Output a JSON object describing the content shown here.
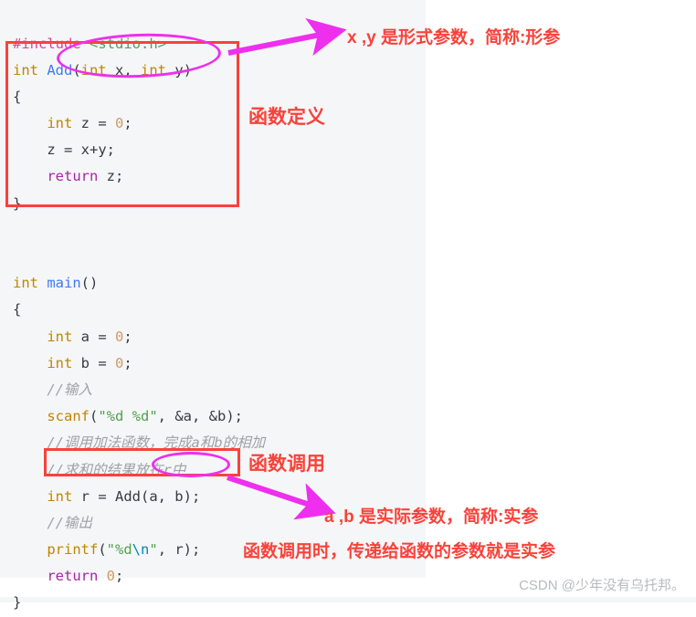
{
  "code_block": {
    "language": "c",
    "background": "#f5f6f7",
    "lines": [
      {
        "tokens": [
          {
            "t": "#include ",
            "c": "k-pre"
          },
          {
            "t": "<stdio.h>",
            "c": "k-inc"
          }
        ]
      },
      {
        "tokens": [
          {
            "t": "int ",
            "c": "k-type"
          },
          {
            "t": "Add",
            "c": "k-fn"
          },
          {
            "t": "(",
            "c": "k-punc"
          },
          {
            "t": "int ",
            "c": "k-type"
          },
          {
            "t": "x",
            "c": "k-id"
          },
          {
            "t": ", ",
            "c": "k-punc"
          },
          {
            "t": "int ",
            "c": "k-type"
          },
          {
            "t": "y",
            "c": "k-id"
          },
          {
            "t": ")",
            "c": "k-punc"
          }
        ]
      },
      {
        "tokens": [
          {
            "t": "{",
            "c": "k-punc"
          }
        ]
      },
      {
        "tokens": [
          {
            "t": "    ",
            "c": "k-punc"
          },
          {
            "t": "int ",
            "c": "k-type"
          },
          {
            "t": "z = ",
            "c": "k-id"
          },
          {
            "t": "0",
            "c": "k-num"
          },
          {
            "t": ";",
            "c": "k-punc"
          }
        ]
      },
      {
        "tokens": [
          {
            "t": "    z = x+y;",
            "c": "k-id"
          }
        ]
      },
      {
        "tokens": [
          {
            "t": "    ",
            "c": "k-punc"
          },
          {
            "t": "return ",
            "c": "k-ret"
          },
          {
            "t": "z;",
            "c": "k-id"
          }
        ]
      },
      {
        "tokens": [
          {
            "t": "}",
            "c": "k-punc"
          }
        ]
      },
      {
        "tokens": []
      },
      {
        "tokens": []
      },
      {
        "tokens": [
          {
            "t": "int ",
            "c": "k-type"
          },
          {
            "t": "main",
            "c": "k-fn"
          },
          {
            "t": "()",
            "c": "k-punc"
          }
        ]
      },
      {
        "tokens": [
          {
            "t": "{",
            "c": "k-punc"
          }
        ]
      },
      {
        "tokens": [
          {
            "t": "    ",
            "c": "k-punc"
          },
          {
            "t": "int ",
            "c": "k-type"
          },
          {
            "t": "a = ",
            "c": "k-id"
          },
          {
            "t": "0",
            "c": "k-num"
          },
          {
            "t": ";",
            "c": "k-punc"
          }
        ]
      },
      {
        "tokens": [
          {
            "t": "    ",
            "c": "k-punc"
          },
          {
            "t": "int ",
            "c": "k-type"
          },
          {
            "t": "b = ",
            "c": "k-id"
          },
          {
            "t": "0",
            "c": "k-num"
          },
          {
            "t": ";",
            "c": "k-punc"
          }
        ]
      },
      {
        "tokens": [
          {
            "t": "    //输入",
            "c": "k-cmt"
          }
        ]
      },
      {
        "tokens": [
          {
            "t": "    ",
            "c": "k-punc"
          },
          {
            "t": "scanf",
            "c": "k-std"
          },
          {
            "t": "(",
            "c": "k-punc"
          },
          {
            "t": "\"%d %d\"",
            "c": "k-str"
          },
          {
            "t": ", &a, &b);",
            "c": "k-id"
          }
        ]
      },
      {
        "tokens": [
          {
            "t": "    //调用加法函数，完成a和b的相加",
            "c": "k-cmt"
          }
        ]
      },
      {
        "tokens": [
          {
            "t": "    //求和的结果放在r中",
            "c": "k-cmt"
          }
        ]
      },
      {
        "tokens": [
          {
            "t": "    ",
            "c": "k-punc"
          },
          {
            "t": "int ",
            "c": "k-type"
          },
          {
            "t": "r = ",
            "c": "k-id"
          },
          {
            "t": "Add",
            "c": "k-id"
          },
          {
            "t": "(a, b);",
            "c": "k-id"
          }
        ]
      },
      {
        "tokens": [
          {
            "t": "    //输出",
            "c": "k-cmt"
          }
        ]
      },
      {
        "tokens": [
          {
            "t": "    ",
            "c": "k-punc"
          },
          {
            "t": "printf",
            "c": "k-std"
          },
          {
            "t": "(",
            "c": "k-punc"
          },
          {
            "t": "\"%d",
            "c": "k-str"
          },
          {
            "t": "\\n",
            "c": "k-esc"
          },
          {
            "t": "\"",
            "c": "k-str"
          },
          {
            "t": ", r);",
            "c": "k-id"
          }
        ]
      },
      {
        "tokens": [
          {
            "t": "    ",
            "c": "k-punc"
          },
          {
            "t": "return ",
            "c": "k-ret"
          },
          {
            "t": "0",
            "c": "k-num"
          },
          {
            "t": ";",
            "c": "k-punc"
          }
        ]
      },
      {
        "tokens": [
          {
            "t": "}",
            "c": "k-punc"
          }
        ]
      }
    ]
  },
  "annotations": {
    "colors": {
      "red": "#f9423a",
      "magenta": "#ee2fee",
      "watermark_gray": "#b8bbbf"
    },
    "label_function_definition": "函数定义",
    "label_function_call": "函数调用",
    "text_formal_parameters": "x ,y 是形式参数，简称:形参",
    "text_actual_parameters": "a ,b 是实际参数，简称:实参",
    "text_call_note": "函数调用时，传递给函数的参数就是实参"
  },
  "watermark": {
    "text": "CSDN @少年没有乌托邦。"
  }
}
